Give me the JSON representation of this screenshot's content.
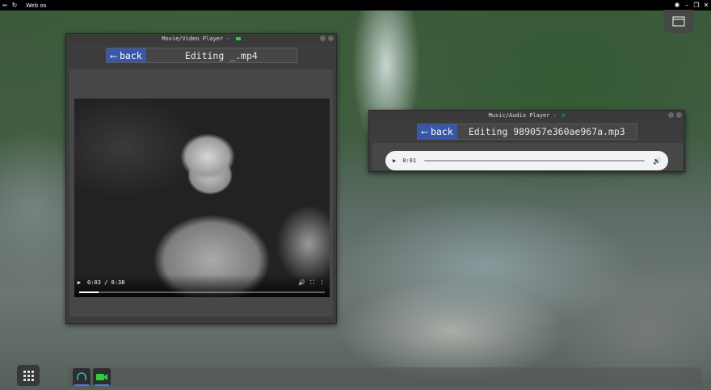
{
  "topbar": {
    "title": "Web os",
    "icons": [
      "arrow-left-icon",
      "refresh-icon",
      "puzzle-icon",
      "minimize-icon",
      "restore-icon",
      "close-icon"
    ]
  },
  "video_window": {
    "title": "Movie/Video Player -",
    "status_color": "#2ecc40",
    "back_label": "back",
    "editing_label": "Editing _.mp4",
    "player": {
      "current_time": "0:03",
      "duration": "0:38",
      "time_display": "0:03 / 0:38",
      "progress": 0.08
    }
  },
  "audio_window": {
    "title": "Music/Audio Player -",
    "back_label": "back",
    "editing_label": "Editing 989057e360ae967a.mp3",
    "player": {
      "current_time": "0:01"
    }
  },
  "dock": {
    "apps": [
      {
        "name": "audio-player-app",
        "icon": "headphones-icon",
        "color": "#35b0c8"
      },
      {
        "name": "video-player-app",
        "icon": "video-camera-icon",
        "color": "#2ecc40"
      }
    ]
  },
  "colors": {
    "back_button": "#3758a8",
    "accent": "#4a7fe0"
  }
}
